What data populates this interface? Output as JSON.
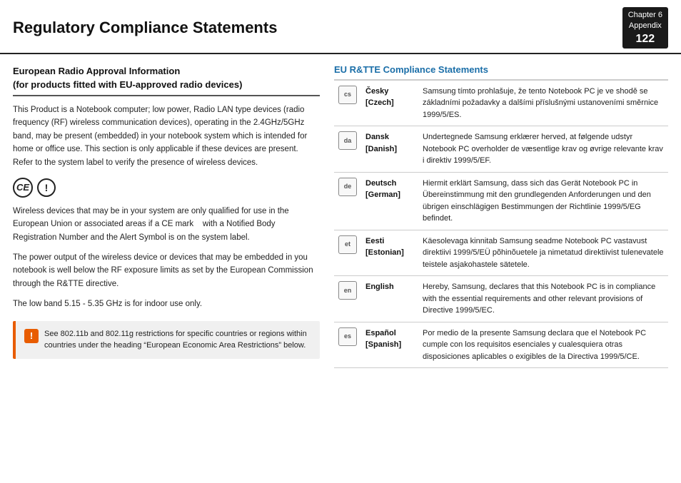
{
  "header": {
    "title": "Regulatory Compliance Statements",
    "chapter_label": "Chapter 6",
    "appendix_label": "Appendix",
    "page_number": "122"
  },
  "left": {
    "heading_line1": "European Radio Approval Information",
    "heading_line2": "(for products fitted with EU-approved radio devices)",
    "body_text": "This Product is a Notebook computer; low power, Radio LAN type devices (radio frequency (RF) wireless communication devices), operating in the 2.4GHz/5GHz band, may be present (embedded) in your notebook system which is intended for home or office use. This section is only applicable if these devices are present. Refer to the system label to verify the presence of wireless devices.",
    "qualified_text": "Wireless devices that may be in your system are only qualified for use in the European Union or associated areas if a CE mark    with a Notified Body Registration Number and the Alert Symbol is on the system label.",
    "power_text": "The power output of the wireless device or devices that may be embedded in you notebook is well below the RF exposure limits as set by the European Commission through the R&TTE directive.",
    "low_band_text": "The low band 5.15 - 5.35 GHz is for indoor use only.",
    "warning_text": "See 802.11b and 802.11g restrictions for specific countries or regions within countries under the heading “European Economic Area Restrictions” below."
  },
  "right": {
    "heading": "EU R&TTE Compliance Statements",
    "rows": [
      {
        "icon_code": "cs",
        "lang_native": "Česky",
        "lang_bracket": "[Czech]",
        "text": "Samsung tímto prohlašuje, že tento Notebook PC je ve shodě se základními požadavky a dalšími příslušnými ustanoveními směrnice 1999/5/ES."
      },
      {
        "icon_code": "da",
        "lang_native": "Dansk",
        "lang_bracket": "[Danish]",
        "text": "Undertegnede Samsung erklærer herved, at følgende udstyr Notebook PC overholder de væsentlige krav og øvrige relevante krav i direktiv 1999/5/EF."
      },
      {
        "icon_code": "de",
        "lang_native": "Deutsch",
        "lang_bracket": "[German]",
        "text": "Hiermit erklärt Samsung, dass sich das Gerät Notebook PC in Übereinstimmung mit den grundlegenden Anforderungen und den übrigen einschlägigen Bestimmungen der Richtlinie 1999/5/EG befindet."
      },
      {
        "icon_code": "et",
        "lang_native": "Eesti",
        "lang_bracket": "[Estonian]",
        "text": "Käesolevaga kinnitab Samsung seadme Notebook PC vastavust direktiivi 1999/5/EÜ põhinõuetele ja nimetatud direktiivist tulenevatele teistele asjakohastele sätetele."
      },
      {
        "icon_code": "en",
        "lang_native": "English",
        "lang_bracket": "",
        "text": "Hereby, Samsung, declares that this Notebook PC is in compliance with the essential requirements and other relevant provisions of Directive 1999/5/EC."
      },
      {
        "icon_code": "es",
        "lang_native": "Español",
        "lang_bracket": "[Spanish]",
        "text": "Por medio de la presente Samsung declara que el Notebook PC cumple con los requisitos esenciales y cualesquiera otras disposiciones aplicables o exigibles de la Directiva 1999/5/CE."
      }
    ]
  }
}
